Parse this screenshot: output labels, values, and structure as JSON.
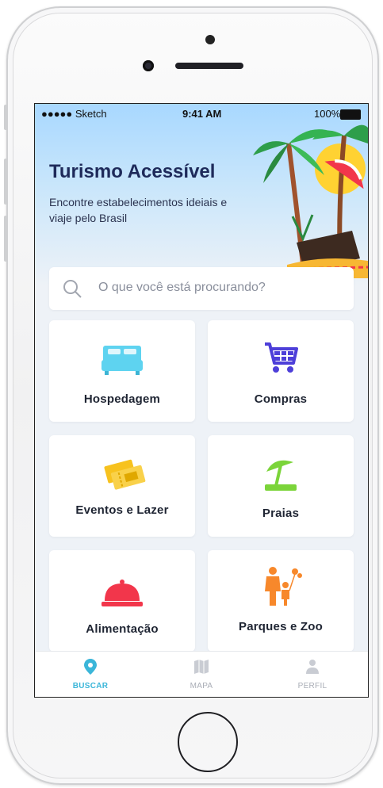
{
  "status_bar": {
    "carrier": "●●●●● Sketch",
    "time": "9:41 AM",
    "battery": "100%"
  },
  "header": {
    "title": "Turismo Acessível",
    "subtitle": "Encontre estabelecimentos ideiais e viaje pelo Brasil"
  },
  "search": {
    "placeholder": "O que você está procurando?"
  },
  "categories": [
    {
      "label": "Hospedagem",
      "icon": "bed-icon",
      "color": "#5ed3f0"
    },
    {
      "label": "Compras",
      "icon": "shopping-cart-icon",
      "color": "#4d3fd9"
    },
    {
      "label": "Eventos e Lazer",
      "icon": "ticket-icon",
      "color": "#f7c21e"
    },
    {
      "label": "Praias",
      "icon": "beach-umbrella-icon",
      "color": "#7bd43a"
    },
    {
      "label": "Alimentação",
      "icon": "food-cloche-icon",
      "color": "#f2364b"
    },
    {
      "label": "Parques e Zoo",
      "icon": "family-balloons-icon",
      "color": "#f7882b"
    }
  ],
  "tab_bar": {
    "active": "BUSCAR",
    "tabs": [
      {
        "label": "BUSCAR",
        "icon": "location-pin-icon"
      },
      {
        "label": "MAPA",
        "icon": "map-icon"
      },
      {
        "label": "PERFIL",
        "icon": "user-icon"
      }
    ]
  },
  "colors": {
    "accent": "#3bb6d9",
    "title": "#1e2a5a"
  }
}
